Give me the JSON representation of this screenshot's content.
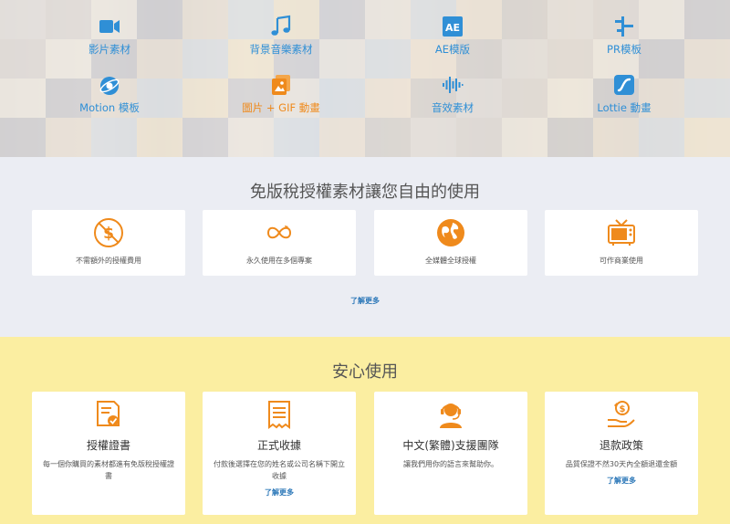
{
  "categories": [
    {
      "label": "影片素材",
      "icon": "video-camera-icon"
    },
    {
      "label": "背景音樂素材",
      "icon": "music-note-icon"
    },
    {
      "label": "AE模版",
      "icon": "after-effects-icon"
    },
    {
      "label": "PR模板",
      "icon": "premiere-timeline-icon"
    },
    {
      "label": "Motion 模板",
      "icon": "motion-icon"
    },
    {
      "label": "圖片 + GIF 動畫",
      "icon": "image-gif-icon"
    },
    {
      "label": "音效素材",
      "icon": "sound-wave-icon"
    },
    {
      "label": "Lottie 動畫",
      "icon": "lottie-icon"
    }
  ],
  "license": {
    "title": "免版稅授權素材讓您自由的使用",
    "cards": [
      {
        "caption": "不需額外的授權費用",
        "icon": "no-fee-icon"
      },
      {
        "caption": "永久使用在多個專案",
        "icon": "infinity-icon"
      },
      {
        "caption": "全媒體全球授權",
        "icon": "globe-icon"
      },
      {
        "caption": "可作商業使用",
        "icon": "tv-icon"
      }
    ],
    "more": "了解更多"
  },
  "safe": {
    "title": "安心使用",
    "cards": [
      {
        "title": "授權證書",
        "desc": "每一個你購買的素材都進有免版稅授權證書",
        "link": "",
        "icon": "certificate-icon"
      },
      {
        "title": "正式收據",
        "desc": "付款後選擇在您的姓名或公司名稱下開立收據",
        "link": "了解更多",
        "icon": "receipt-icon"
      },
      {
        "title": "中文(繁體)支援團隊",
        "desc": "讓我們用你的語言來幫助你。",
        "link": "",
        "icon": "support-agent-icon"
      },
      {
        "title": "退款政策",
        "desc": "品質保證不然30天內全額退還金額",
        "link": "了解更多",
        "icon": "refund-icon"
      }
    ]
  },
  "colors": {
    "blue": "#2f8fd6",
    "orange": "#ef8a1c",
    "link": "#2b77b8",
    "license_bg": "#ebedf3",
    "safe_bg": "#fbeea1"
  }
}
